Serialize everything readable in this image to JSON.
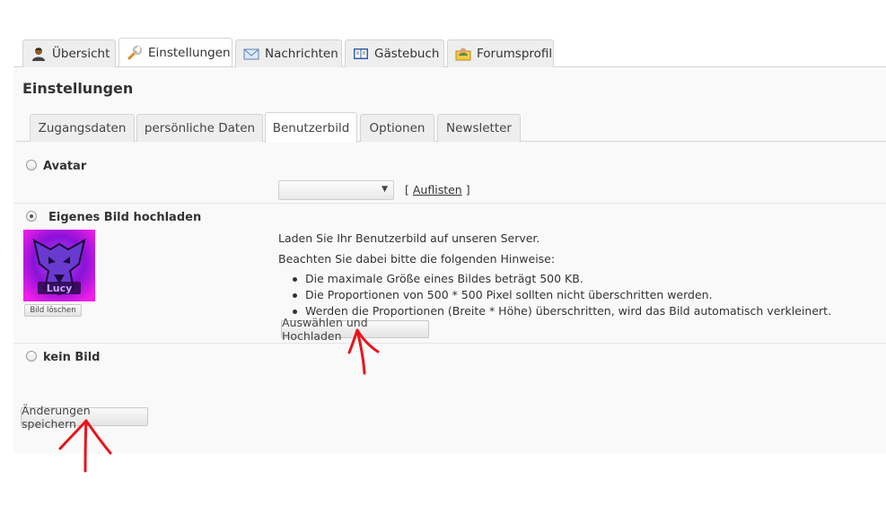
{
  "top_tabs": [
    {
      "label": "Übersicht",
      "icon": "user-icon",
      "active": false
    },
    {
      "label": "Einstellungen",
      "icon": "wrench-icon",
      "active": true
    },
    {
      "label": "Nachrichten",
      "icon": "envelope-icon",
      "active": false
    },
    {
      "label": "Gästebuch",
      "icon": "book-icon",
      "active": false
    },
    {
      "label": "Forumsprofil",
      "icon": "profile-folder-icon",
      "active": false
    }
  ],
  "page_title": "Einstellungen",
  "sub_tabs": [
    {
      "label": "Zugangsdaten",
      "active": false
    },
    {
      "label": "persönliche Daten",
      "active": false
    },
    {
      "label": "Benutzerbild",
      "active": true
    },
    {
      "label": "Optionen",
      "active": false
    },
    {
      "label": "Newsletter",
      "active": false
    }
  ],
  "avatar_option": {
    "label": "Avatar",
    "selected": false,
    "select_value": "",
    "list_bracket_open": "[",
    "list_link": "Auflisten",
    "list_bracket_close": "]"
  },
  "upload_option": {
    "label": "Eigenes Bild hochladen",
    "selected": true,
    "image_text": "Lucy",
    "delete_button": "Bild löschen",
    "intro": "Laden Sie Ihr Benutzerbild auf unseren Server.",
    "hints_intro": "Beachten Sie dabei bitte die folgenden Hinweise:",
    "hints": [
      "Die maximale Größe eines Bildes beträgt 500 KB.",
      "Die Proportionen von 500 * 500 Pixel sollten nicht überschritten werden.",
      "Werden die Proportionen (Breite * Höhe) überschritten, wird das Bild automatisch verkleinert."
    ],
    "upload_button": "Auswählen und Hochladen"
  },
  "none_option": {
    "label": "kein Bild",
    "selected": false
  },
  "save_button": "Änderungen speichern",
  "colors": {
    "annotation_red": "#e8141c",
    "avatar_purple": "#a020f0",
    "avatar_magenta": "#e020e0"
  }
}
